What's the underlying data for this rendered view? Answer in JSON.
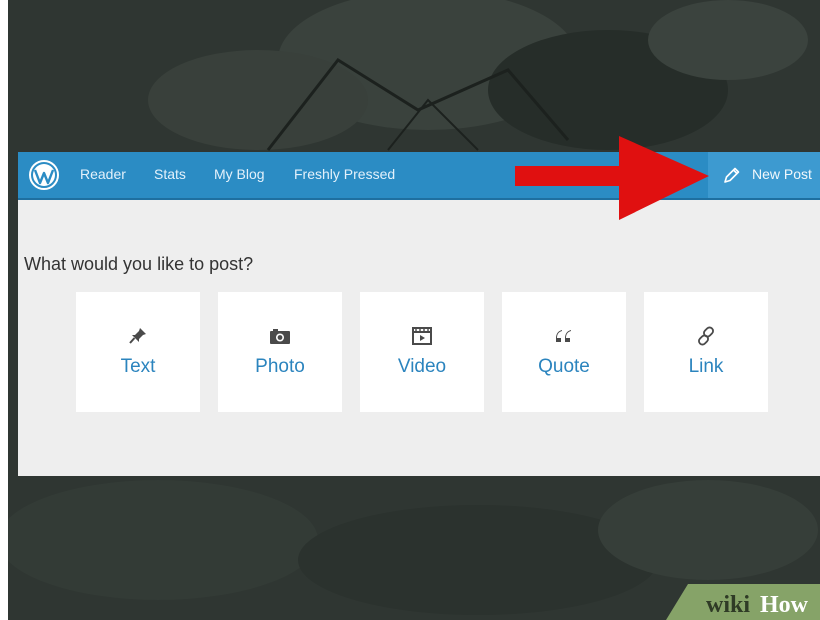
{
  "nav": {
    "items": [
      {
        "label": "Reader"
      },
      {
        "label": "Stats"
      },
      {
        "label": "My Blog"
      },
      {
        "label": "Freshly Pressed"
      }
    ],
    "new_post_label": "New Post"
  },
  "main": {
    "prompt": "What would you like to post?",
    "post_types": [
      {
        "label": "Text",
        "icon": "pin-icon"
      },
      {
        "label": "Photo",
        "icon": "camera-icon"
      },
      {
        "label": "Video",
        "icon": "video-icon"
      },
      {
        "label": "Quote",
        "icon": "quote-icon"
      },
      {
        "label": "Link",
        "icon": "link-icon"
      }
    ]
  },
  "watermark": {
    "text": "wikiHow"
  },
  "colors": {
    "topbar": "#2b8cc4",
    "new_post_bg": "#3d9ad0",
    "panel": "#eeeeee",
    "card_label": "#2b84be",
    "arrow": "#e01010",
    "background": "#2f3632"
  }
}
